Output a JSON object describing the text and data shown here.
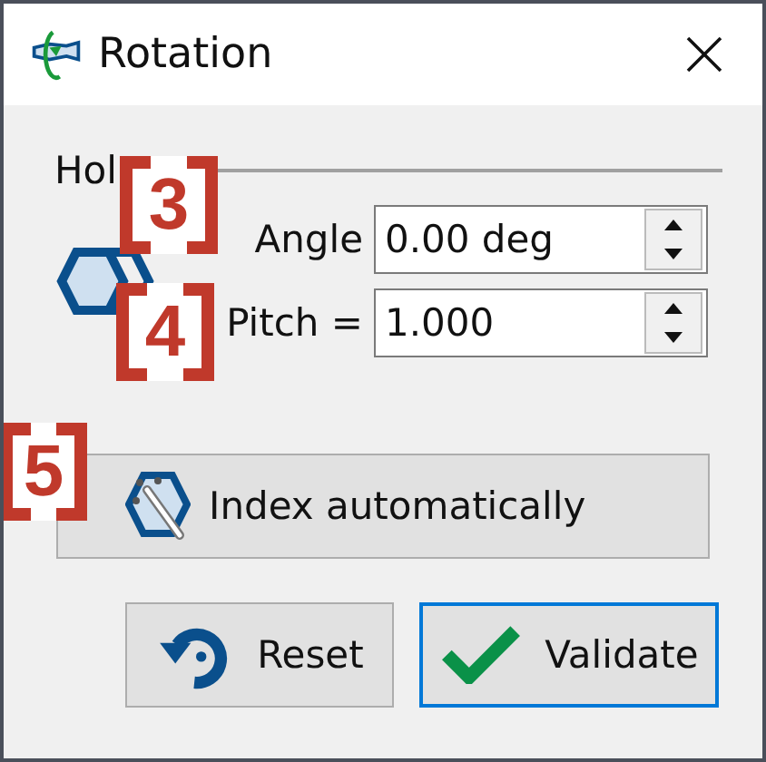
{
  "window": {
    "title": "Rotation"
  },
  "group": {
    "title": "Hol"
  },
  "fields": [
    {
      "label": "Angle",
      "value": "0.00 deg"
    },
    {
      "label": "Pitch =",
      "value": "1.000"
    }
  ],
  "index_button": {
    "label": "Index automatically"
  },
  "buttons": [
    {
      "kind": "reset",
      "label": "Reset",
      "default": false
    },
    {
      "kind": "validate",
      "label": "Validate",
      "default": true
    }
  ],
  "callouts": [
    {
      "number": "3"
    },
    {
      "number": "4"
    },
    {
      "number": "5"
    }
  ]
}
